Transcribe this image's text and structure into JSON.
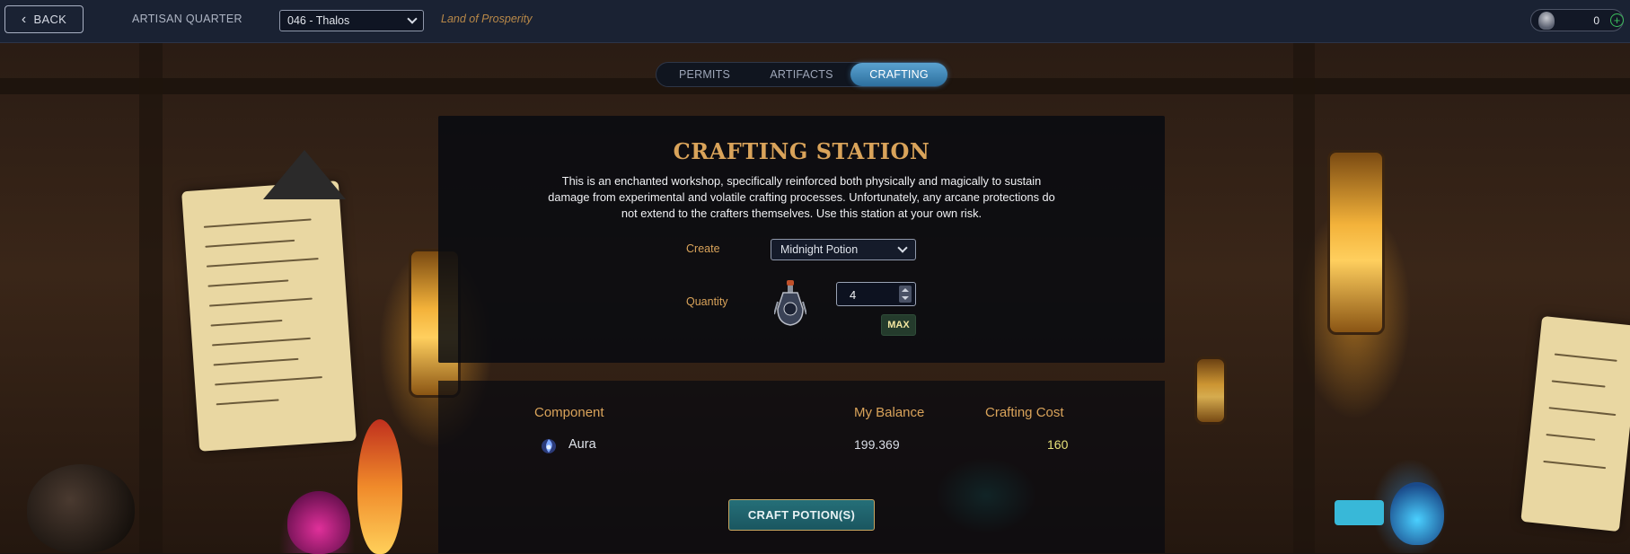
{
  "header": {
    "back_label": "BACK",
    "section_title": "ARTISAN QUARTER",
    "realm_select_value": "046 - Thalos",
    "land_name": "Land of Prosperity",
    "wallet_balance": "0"
  },
  "tabs": [
    {
      "label": "PERMITS",
      "active": false
    },
    {
      "label": "ARTIFACTS",
      "active": false
    },
    {
      "label": "CRAFTING",
      "active": true
    }
  ],
  "station": {
    "title": "CRAFTING STATION",
    "description": "This is an enchanted workshop, specifically reinforced both physically and magically to sustain damage from experimental and volatile crafting processes. Unfortunately, any arcane protections do not extend to the crafters themselves. Use this station at your own risk.",
    "create_label": "Create",
    "create_value": "Midnight Potion",
    "quantity_label": "Quantity",
    "quantity_value": "4",
    "max_label": "MAX"
  },
  "components": {
    "headers": {
      "component": "Component",
      "balance": "My Balance",
      "cost": "Crafting Cost"
    },
    "rows": [
      {
        "name": "Aura",
        "icon": "aura-icon",
        "balance": "199.369",
        "cost": "160"
      }
    ]
  },
  "craft_button_label": "CRAFT POTION(S)",
  "colors": {
    "accent_gold": "#d9a35a",
    "active_tab": "#3b86b8",
    "craft_button": "#1f636c",
    "cost_highlight": "#e8e27a"
  }
}
